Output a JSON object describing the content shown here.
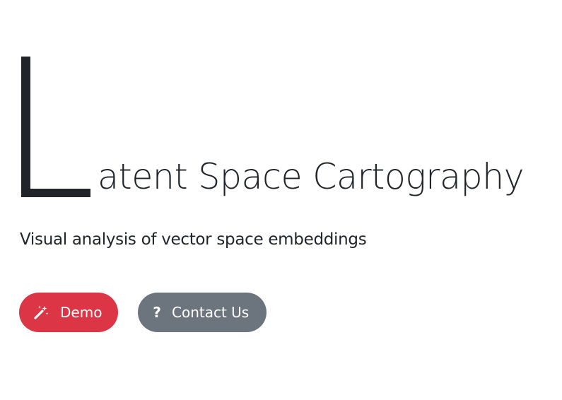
{
  "hero": {
    "title_initial": "L",
    "title_rest": "atent Space Cartography",
    "subtitle": "Visual analysis of vector space embeddings"
  },
  "buttons": {
    "demo": {
      "label": "Demo",
      "icon": "magic-wand-icon",
      "color": "#dc3545"
    },
    "contact": {
      "label": "Contact Us",
      "icon": "question-icon",
      "icon_glyph": "?",
      "color": "#6c757d"
    }
  }
}
